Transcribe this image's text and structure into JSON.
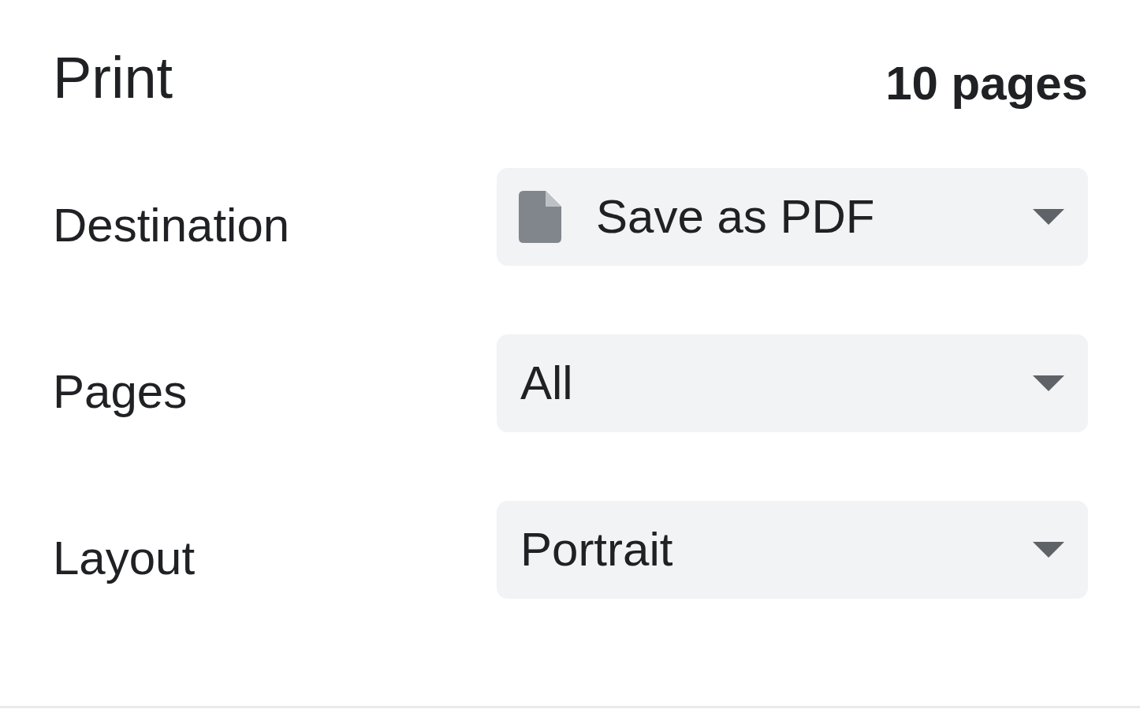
{
  "header": {
    "title": "Print",
    "page_count": "10 pages"
  },
  "settings": [
    {
      "label": "Destination",
      "kind": "file",
      "value": "Save as PDF"
    },
    {
      "label": "Pages",
      "kind": "plain",
      "value": "All"
    },
    {
      "label": "Layout",
      "kind": "plain",
      "value": "Portrait"
    }
  ]
}
